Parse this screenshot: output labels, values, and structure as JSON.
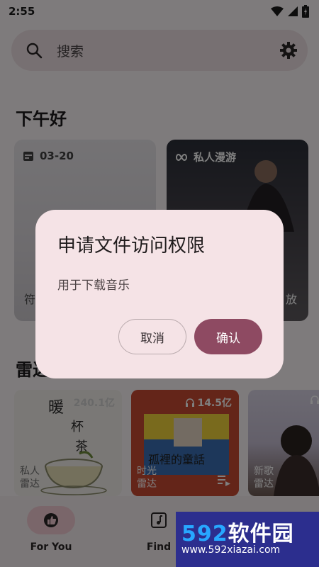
{
  "status_bar": {
    "time": "2:55"
  },
  "search": {
    "placeholder": "搜索"
  },
  "greeting": "下午好",
  "cards": [
    {
      "chip": "03-20",
      "caption": "符"
    },
    {
      "chip": "私人漫游",
      "caption": "放"
    }
  ],
  "radar": {
    "title": "雷达",
    "tiles": [
      {
        "count": "240.1亿",
        "name": "私人雷达"
      },
      {
        "count": "14.5亿",
        "name": "时光雷达"
      },
      {
        "count": "",
        "name": "新歌雷达"
      }
    ]
  },
  "dialog": {
    "title": "申请文件访问权限",
    "message": "用于下载音乐",
    "cancel": "取消",
    "confirm": "确认"
  },
  "nav": {
    "for_you": "For You",
    "find": "Find"
  },
  "watermark": {
    "text_num": "592",
    "text": "软件园",
    "url": "www.592xiazai.com"
  },
  "colors": {
    "accent": "#8e4a62",
    "dialog_bg": "#f5e3e6",
    "nav_active": "#f4ccd5"
  }
}
